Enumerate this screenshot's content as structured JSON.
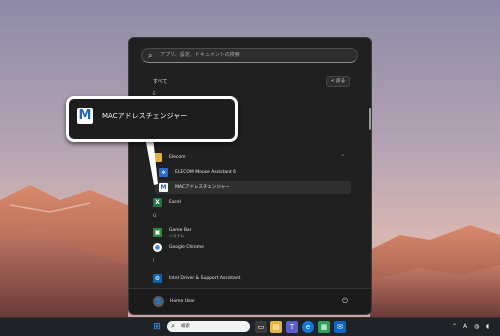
{
  "start_menu": {
    "search_placeholder": "アプリ、設定、ドキュメントの検索",
    "section_title": "すべて",
    "back_label": "< 戻る",
    "letter_e": "E",
    "letter_g": "G",
    "letter_i": "I",
    "items": {
      "elecom_folder": "Elecom",
      "mouse_assistant": "ELECOM Mouse Assistant 6",
      "mac_changer": "MACアドレスチェンジャー",
      "excel": "Excel",
      "game_bar": "Game Bar",
      "game_bar_sub": "システム",
      "chrome": "Google Chrome",
      "intel": "Intel Driver & Support Assistant"
    },
    "user_name": "Home User"
  },
  "callout": {
    "label": "MACアドレスチェンジャー",
    "icon_letter": "M"
  },
  "taskbar": {
    "search_label": "検索",
    "ime_label": "A"
  },
  "colors": {
    "menu_bg": "#202020",
    "taskbar_bg": "#1f2226",
    "accent_blue": "#1f67c6",
    "callout_border": "#ffffff"
  }
}
